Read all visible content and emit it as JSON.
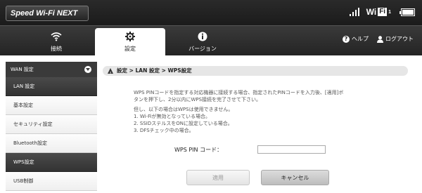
{
  "header": {
    "brand": "Speed Wi-Fi NEXT",
    "wifi_label": "Wi",
    "wifi_box": "Fi",
    "wifi_sub": "1"
  },
  "nav": {
    "tabs": [
      {
        "label": "接続",
        "icon": "wifi-icon"
      },
      {
        "label": "設定",
        "icon": "gear-icon",
        "active": true
      },
      {
        "label": "バージョン",
        "icon": "info-icon"
      }
    ],
    "help": "ヘルプ",
    "logout": "ログアウト"
  },
  "sidebar": {
    "section": "WAN 設定",
    "items": [
      {
        "label": "LAN 設定",
        "dark": true
      },
      {
        "label": "基本設定"
      },
      {
        "label": "セキュリティ設定"
      },
      {
        "label": "Bluetooth設定"
      },
      {
        "label": "WPS設定",
        "dark": true
      },
      {
        "label": "USB制御"
      }
    ]
  },
  "breadcrumb": "設定 > LAN 設定 > WPS設定",
  "description": {
    "line1": "WPS PINコードを指定する対応機器に接続する場合、指定されたPINコードを入力後、[適用]ボ",
    "line2": "タンを押下し、2分以内にWPS接続を完了させて下さい。",
    "line3": "但し、以下の場合はWPSは使用できません。",
    "line4": "1. Wi-Fiが無効となっている場合。",
    "line5": "2. SSIDステルスをONに設定している場合。",
    "line6": "3. DFSチェック中の場合。"
  },
  "form": {
    "pin_label": "WPS PIN コード：",
    "pin_value": "",
    "apply": "適用",
    "cancel": "キャンセル"
  }
}
